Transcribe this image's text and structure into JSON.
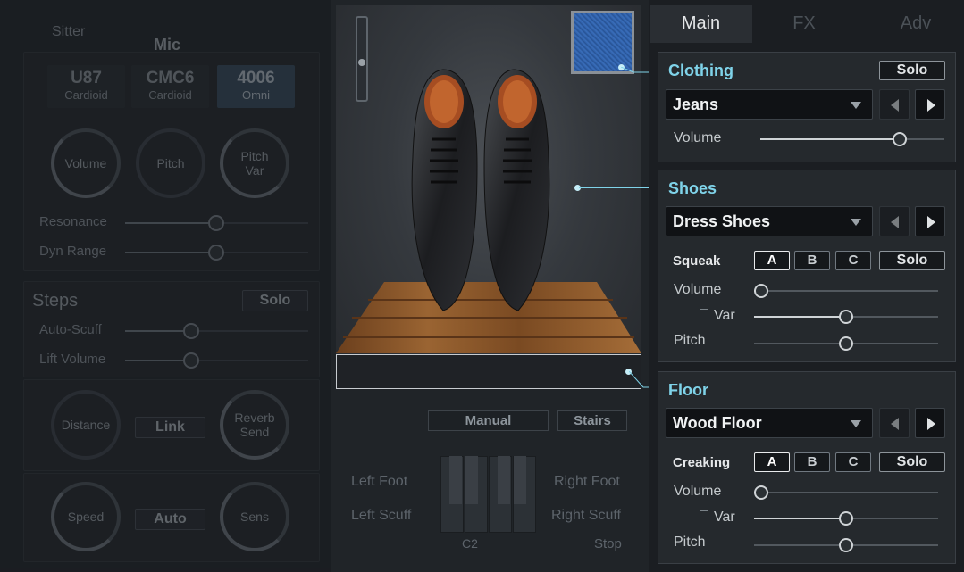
{
  "left": {
    "mic_label": "Mic",
    "top_left_label": "Sitter",
    "mics": [
      {
        "name": "U87",
        "pattern": "Cardioid"
      },
      {
        "name": "CMC6",
        "pattern": "Cardioid"
      },
      {
        "name": "4006",
        "pattern": "Omni"
      }
    ],
    "knobs_row1": [
      "Volume",
      "Pitch",
      "Pitch\nVar"
    ],
    "resonance": "Resonance",
    "dyn_range": "Dyn Range",
    "steps_title": "Steps",
    "steps_solo": "Solo",
    "auto_scuff": "Auto-Scuff",
    "lift_volume": "Lift Volume",
    "distance": "Distance",
    "link": "Link",
    "reverb_send": "Reverb\nSend",
    "speed": "Speed",
    "auto": "Auto",
    "sens": "Sens"
  },
  "center": {
    "mode_manual": "Manual",
    "mode_stairs": "Stairs",
    "left_foot": "Left Foot",
    "right_foot": "Right Foot",
    "left_scuff": "Left Scuff",
    "right_scuff": "Right Scuff",
    "note": "C2",
    "stop": "Stop"
  },
  "tabs": [
    {
      "label": "Main"
    },
    {
      "label": "FX"
    },
    {
      "label": "Adv"
    }
  ],
  "clothing": {
    "title": "Clothing",
    "solo": "Solo",
    "selected": "Jeans",
    "volume_label": "Volume",
    "volume": 0.78
  },
  "shoes": {
    "title": "Shoes",
    "selected": "Dress Shoes",
    "squeak_label": "Squeak",
    "options": [
      "A",
      "B",
      "C"
    ],
    "active_option": "A",
    "solo": "Solo",
    "volume_label": "Volume",
    "var_label": "Var",
    "pitch_label": "Pitch",
    "volume": 0.0,
    "var": 0.5,
    "pitch": 0.5
  },
  "floor": {
    "title": "Floor",
    "selected": "Wood Floor",
    "creaking_label": "Creaking",
    "options": [
      "A",
      "B",
      "C"
    ],
    "active_option": "A",
    "solo": "Solo",
    "volume_label": "Volume",
    "var_label": "Var",
    "pitch_label": "Pitch",
    "volume": 0.0,
    "var": 0.5,
    "pitch": 0.5
  },
  "colors": {
    "accent": "#7fd3e9",
    "background": "#1b1e22",
    "panel": "#25292d"
  }
}
